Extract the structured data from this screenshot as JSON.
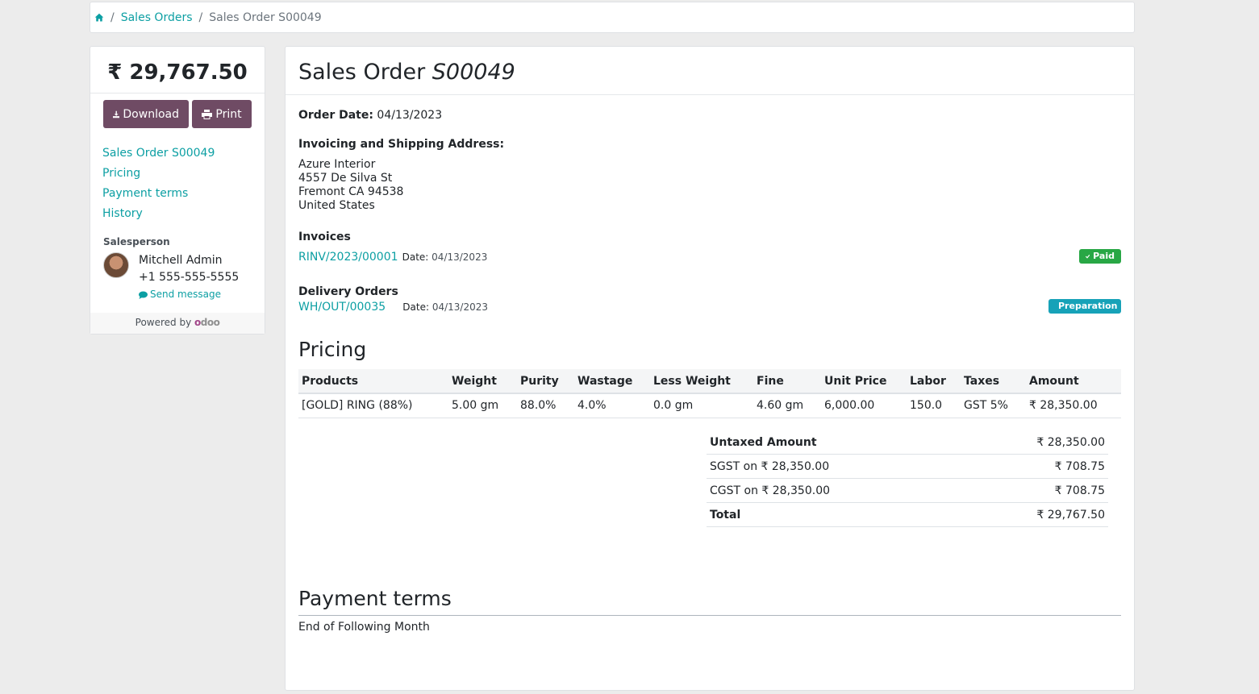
{
  "breadcrumb": {
    "items": [
      "Sales Orders"
    ],
    "current": "Sales Order S00049"
  },
  "sidebar": {
    "amount": "₹ 29,767.50",
    "download_label": "Download",
    "print_label": "Print",
    "nav": [
      "Sales Order S00049",
      "Pricing",
      "Payment terms",
      "History"
    ],
    "salesperson_label": "Salesperson",
    "salesperson_name": "Mitchell Admin",
    "salesperson_phone": "+1 555-555-5555",
    "send_message": "Send message",
    "powered_by": "Powered by",
    "logo_text": "odoo"
  },
  "order": {
    "title_prefix": "Sales Order",
    "title_number": "S00049",
    "order_date_label": "Order Date:",
    "order_date": "04/13/2023",
    "address_label": "Invoicing and Shipping Address:",
    "address_lines": [
      "Azure Interior",
      "4557 De Silva St",
      "Fremont CA 94538",
      "United States"
    ],
    "invoices_label": "Invoices",
    "invoice_ref": "RINV/2023/00001",
    "invoice_date_label": "Date:",
    "invoice_date": "04/13/2023",
    "invoice_status": "Paid",
    "delivery_label": "Delivery Orders",
    "delivery_ref": "WH/OUT/00035",
    "delivery_date_label": "Date:",
    "delivery_date": "04/13/2023",
    "delivery_status": "Preparation"
  },
  "pricing": {
    "title": "Pricing",
    "headers": [
      "Products",
      "Weight",
      "Purity",
      "Wastage",
      "Less Weight",
      "Fine",
      "Unit Price",
      "Labor",
      "Taxes",
      "Amount"
    ],
    "rows": [
      [
        "[GOLD] RING (88%)",
        "5.00 gm",
        "88.0%",
        "4.0%",
        "0.0 gm",
        "4.60 gm",
        "6,000.00",
        "150.0",
        "GST 5%",
        "₹ 28,350.00"
      ]
    ],
    "totals": [
      {
        "label": "Untaxed Amount",
        "value": "₹ 28,350.00",
        "bold": true
      },
      {
        "label": "SGST on ₹ 28,350.00",
        "value": "₹ 708.75",
        "bold": false
      },
      {
        "label": "CGST on ₹ 28,350.00",
        "value": "₹ 708.75",
        "bold": false
      },
      {
        "label": "Total",
        "value": "₹ 29,767.50",
        "bold": true
      }
    ]
  },
  "payment_terms": {
    "title": "Payment terms",
    "text": "End of Following Month"
  },
  "colors": {
    "accent": "#0c9fa3",
    "button": "#6f4b64",
    "paid": "#28a745",
    "preparation": "#17a2b8"
  }
}
